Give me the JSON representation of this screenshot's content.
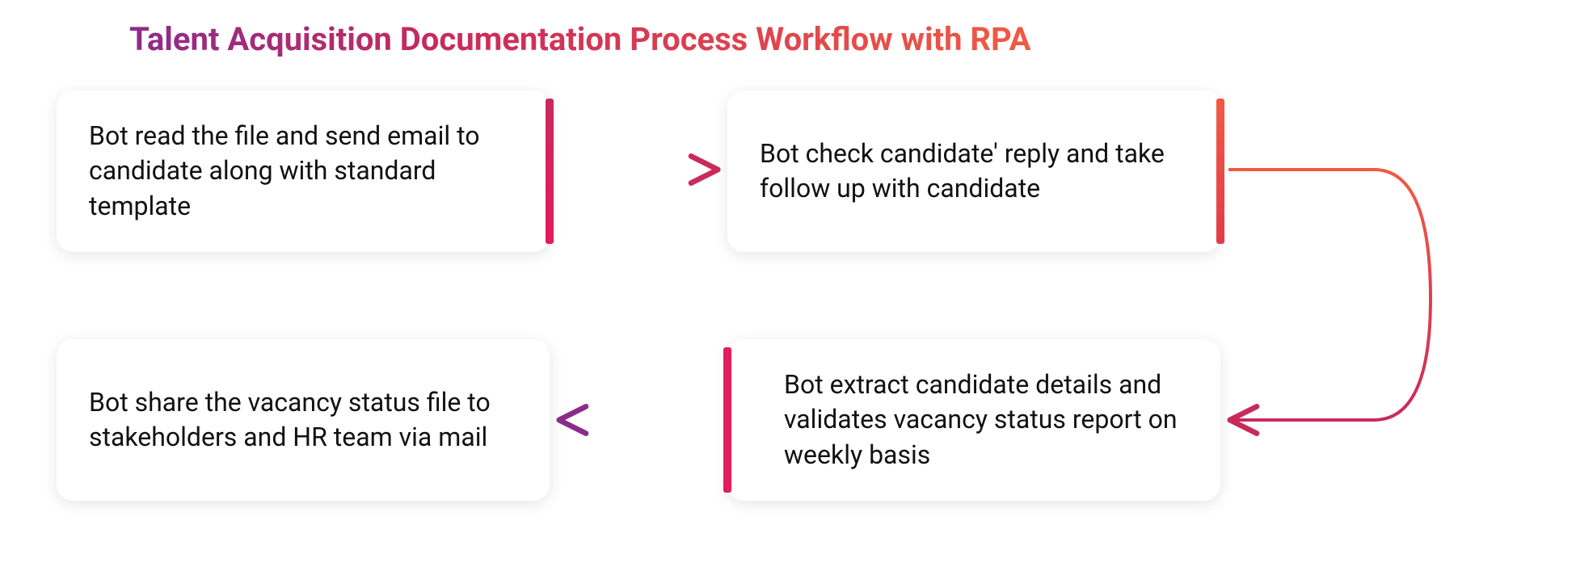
{
  "title": "Talent Acquisition Documentation Process Workflow with RPA",
  "steps": {
    "step1": "Bot read the file and send email to candidate along with standard template",
    "step2": "Bot check candidate' reply and take follow up with candidate",
    "step3": "Bot extract candidate details and validates vacancy status report on weekly basis",
    "step4": "Bot share the vacancy status file to stakeholders and HR team via mail"
  },
  "colors": {
    "purple": "#8B2C8C",
    "crimson": "#E31B5F",
    "orange": "#F15A42"
  }
}
